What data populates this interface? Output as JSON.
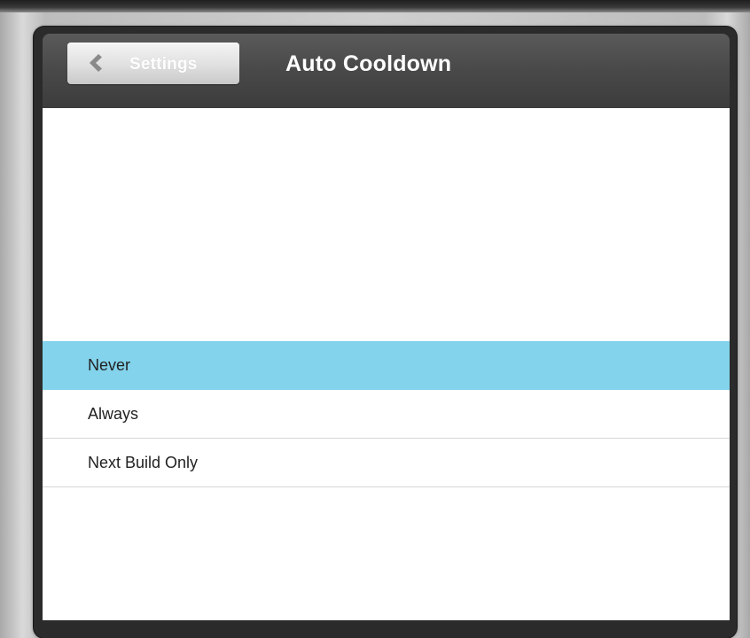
{
  "nav": {
    "back_label": "Settings",
    "title": "Auto Cooldown"
  },
  "options": [
    {
      "label": "Never",
      "selected": true
    },
    {
      "label": "Always",
      "selected": false
    },
    {
      "label": "Next Build Only",
      "selected": false
    }
  ],
  "colors": {
    "selection": "#82d3eb",
    "nav_bar": "#4a4a4a"
  },
  "icons": {
    "back": "chevron-left-icon"
  }
}
